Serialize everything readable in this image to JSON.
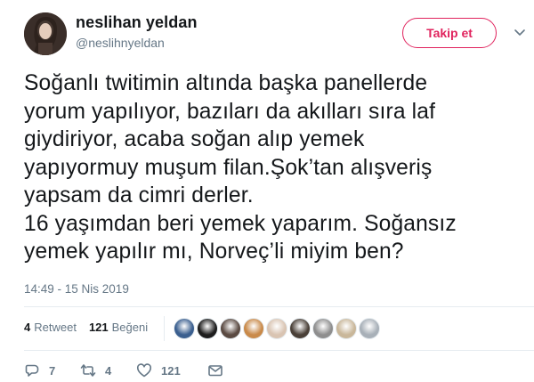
{
  "user": {
    "display_name": "neslihan yeldan",
    "handle": "@neslihnyeldan"
  },
  "follow_button": {
    "label": "Takip et"
  },
  "tweet": {
    "text": "Soğanlı twitimin altında başka panellerde\nyorum yapılıyor, bazıları da akılları sıra laf\ngiydiriyor, acaba soğan alıp yemek\nyapıyormuy muşum filan.Şok’tan alışveriş\nyapsam da cimri derler.\n16 yaşımdan beri yemek yaparım. Soğansız\nyemek yapılır mı, Norveç’li miyim ben?",
    "timestamp": "14:49 - 15 Nis 2019"
  },
  "stats": {
    "retweet_count": "4",
    "retweet_label": "Retweet",
    "like_count": "121",
    "like_label": "Beğeni"
  },
  "likers": [
    {
      "name": "liker-avatar-1",
      "color": "#3b5f8f"
    },
    {
      "name": "liker-avatar-2",
      "color": "#1d1d1d"
    },
    {
      "name": "liker-avatar-3",
      "color": "#5a4a42"
    },
    {
      "name": "liker-avatar-4",
      "color": "#c98a4a"
    },
    {
      "name": "liker-avatar-5",
      "color": "#d9c4b2"
    },
    {
      "name": "liker-avatar-6",
      "color": "#4a4038"
    },
    {
      "name": "liker-avatar-7",
      "color": "#8e8e8e"
    },
    {
      "name": "liker-avatar-8",
      "color": "#c9b79a"
    },
    {
      "name": "liker-avatar-9",
      "color": "#a8b0b8"
    }
  ],
  "actions": {
    "reply_count": "7",
    "retweet_count": "4",
    "like_count": "121"
  },
  "icons": {
    "reply": "reply-icon",
    "retweet": "retweet-icon",
    "like": "heart-icon",
    "message": "envelope-icon",
    "more": "chevron-down-icon"
  },
  "colors": {
    "accent": "#e0245e",
    "secondary_text": "#657786",
    "primary_text": "#14171a",
    "divider": "#e6ecf0"
  }
}
